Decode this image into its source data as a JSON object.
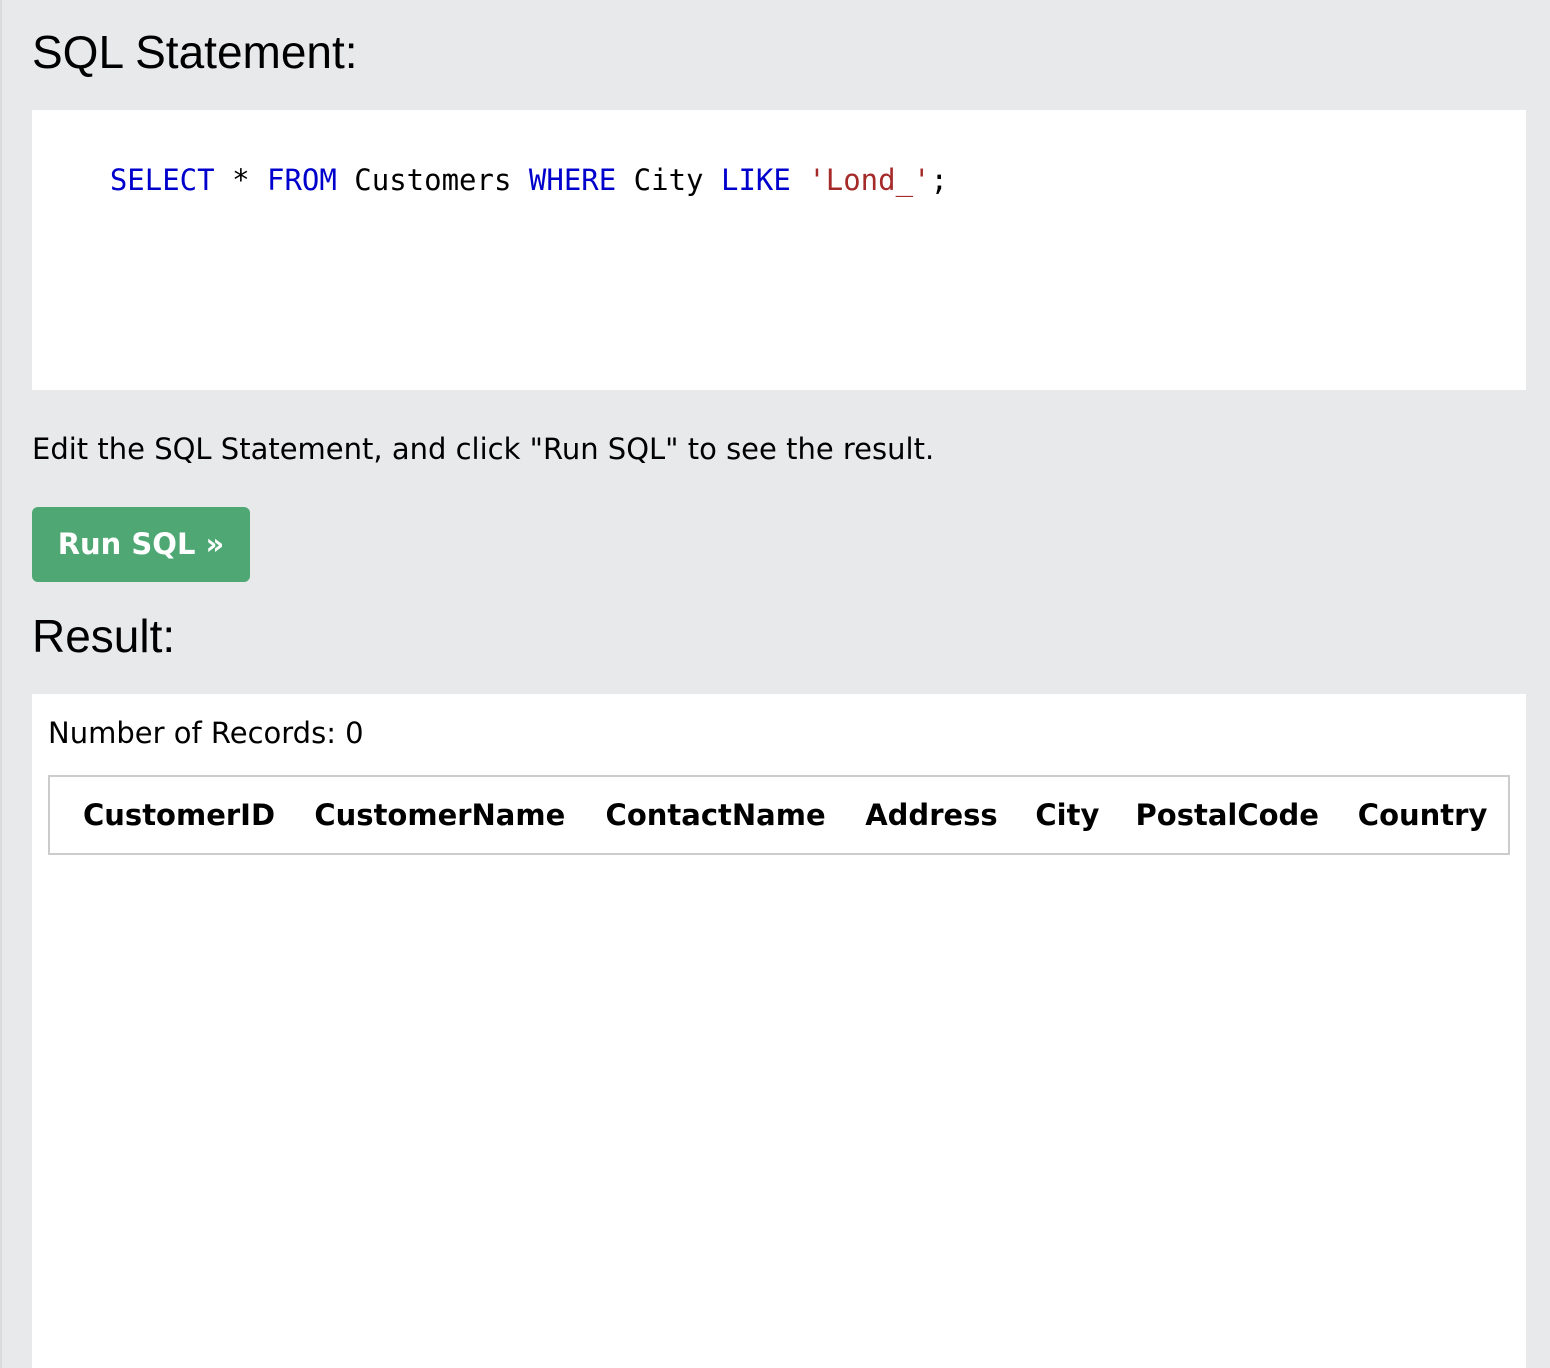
{
  "page": {
    "sql_heading": "SQL Statement:",
    "instruction": "Edit the SQL Statement, and click \"Run SQL\" to see the result.",
    "run_button_label": "Run SQL »",
    "result_heading": "Result:"
  },
  "editor": {
    "tokens": [
      {
        "text": "SELECT",
        "type": "keyword"
      },
      {
        "text": " * ",
        "type": "plain"
      },
      {
        "text": "FROM",
        "type": "keyword"
      },
      {
        "text": " Customers ",
        "type": "plain"
      },
      {
        "text": "WHERE",
        "type": "keyword"
      },
      {
        "text": " City ",
        "type": "plain"
      },
      {
        "text": "LIKE",
        "type": "keyword"
      },
      {
        "text": " ",
        "type": "plain"
      },
      {
        "text": "'Lond_'",
        "type": "string"
      },
      {
        "text": ";",
        "type": "plain"
      }
    ]
  },
  "result": {
    "records_text": "Number of Records: 0",
    "columns": [
      "CustomerID",
      "CustomerName",
      "ContactName",
      "Address",
      "City",
      "PostalCode",
      "Country"
    ],
    "rows": []
  },
  "colors": {
    "keyword": "#0000cd",
    "string": "#a52a2a",
    "button": "#4fa874",
    "background": "#e7e9eb"
  }
}
